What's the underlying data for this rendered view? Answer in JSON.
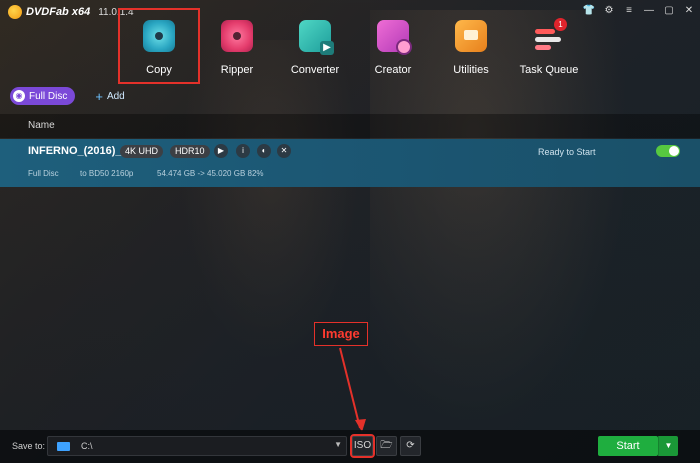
{
  "titlebar": {
    "app_name": "DVDFab x64",
    "version": "11.0.1.4"
  },
  "nav": {
    "items": [
      {
        "label": "Copy",
        "icon": "copy-icon"
      },
      {
        "label": "Ripper",
        "icon": "ripper-icon"
      },
      {
        "label": "Converter",
        "icon": "converter-icon"
      },
      {
        "label": "Creator",
        "icon": "creator-icon"
      },
      {
        "label": "Utilities",
        "icon": "utilities-icon"
      },
      {
        "label": "Task Queue",
        "icon": "task-queue-icon",
        "badge": "1"
      }
    ]
  },
  "mode": {
    "label": "Full Disc",
    "add_label": "Add"
  },
  "list": {
    "column_name": "Name"
  },
  "row": {
    "title": "INFERNO_(2016)_",
    "tag_4k": "4K UHD",
    "tag_hdr": "HDR10",
    "status": "Ready to Start",
    "enabled": true,
    "mode": "Full Disc",
    "target": "to BD50 2160p",
    "size": "54.474 GB -> 45.020 GB 82%"
  },
  "annotation": {
    "label": "Image"
  },
  "bottom": {
    "save_to_label": "Save to:",
    "save_path": "C:\\",
    "start_label": "Start"
  },
  "colors": {
    "accent_red": "#e4312a",
    "start_green": "#1fae3f",
    "mode_purple": "#7b49d8",
    "toggle_green": "#57c940"
  }
}
